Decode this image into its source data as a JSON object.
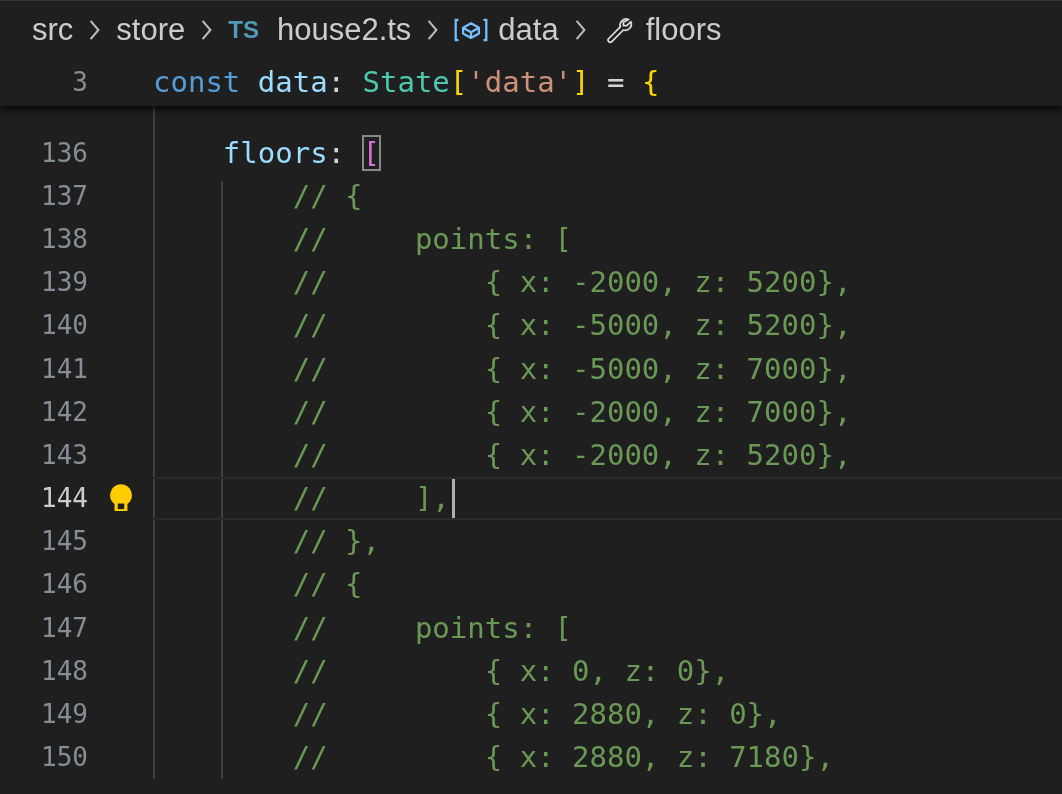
{
  "breadcrumb": [
    {
      "kind": "folder",
      "label": "src"
    },
    {
      "kind": "folder",
      "label": "store"
    },
    {
      "kind": "file",
      "badge": "TS",
      "label": "house2.ts"
    },
    {
      "kind": "variable",
      "label": "data"
    },
    {
      "kind": "property",
      "label": "floors"
    }
  ],
  "sticky_line": {
    "number": "3",
    "tokens": [
      {
        "kind": "keyword",
        "text": "const "
      },
      {
        "kind": "variable",
        "text": "data"
      },
      {
        "kind": "plain",
        "text": ": "
      },
      {
        "kind": "type",
        "text": "State"
      },
      {
        "kind": "bracket",
        "text": "["
      },
      {
        "kind": "string",
        "text": "'data'"
      },
      {
        "kind": "bracket",
        "text": "]"
      },
      {
        "kind": "plain",
        "text": " = "
      },
      {
        "kind": "bracket",
        "text": "{"
      }
    ]
  },
  "lines": [
    {
      "number": "136",
      "current": false,
      "tokens": [
        {
          "kind": "variable",
          "text": "    floors"
        },
        {
          "kind": "plain",
          "text": ": "
        },
        {
          "kind": "bracket2",
          "text": "[",
          "matched": true
        }
      ]
    },
    {
      "number": "137",
      "current": false,
      "tokens": [
        {
          "kind": "comment",
          "text": "        // {"
        }
      ]
    },
    {
      "number": "138",
      "current": false,
      "tokens": [
        {
          "kind": "comment",
          "text": "        //     points: ["
        }
      ]
    },
    {
      "number": "139",
      "current": false,
      "tokens": [
        {
          "kind": "comment",
          "text": "        //         { x: -2000, z: 5200},"
        }
      ]
    },
    {
      "number": "140",
      "current": false,
      "tokens": [
        {
          "kind": "comment",
          "text": "        //         { x: -5000, z: 5200},"
        }
      ]
    },
    {
      "number": "141",
      "current": false,
      "tokens": [
        {
          "kind": "comment",
          "text": "        //         { x: -5000, z: 7000},"
        }
      ]
    },
    {
      "number": "142",
      "current": false,
      "tokens": [
        {
          "kind": "comment",
          "text": "        //         { x: -2000, z: 7000},"
        }
      ]
    },
    {
      "number": "143",
      "current": false,
      "tokens": [
        {
          "kind": "comment",
          "text": "        //         { x: -2000, z: 5200},"
        }
      ]
    },
    {
      "number": "144",
      "current": true,
      "tokens": [
        {
          "kind": "comment",
          "text": "        //     ],"
        }
      ]
    },
    {
      "number": "145",
      "current": false,
      "tokens": [
        {
          "kind": "comment",
          "text": "        // },"
        }
      ]
    },
    {
      "number": "146",
      "current": false,
      "tokens": [
        {
          "kind": "comment",
          "text": "        // {"
        }
      ]
    },
    {
      "number": "147",
      "current": false,
      "tokens": [
        {
          "kind": "comment",
          "text": "        //     points: ["
        }
      ]
    },
    {
      "number": "148",
      "current": false,
      "tokens": [
        {
          "kind": "comment",
          "text": "        //         { x: 0, z: 0},"
        }
      ]
    },
    {
      "number": "149",
      "current": false,
      "tokens": [
        {
          "kind": "comment",
          "text": "        //         { x: 2880, z: 0},"
        }
      ]
    },
    {
      "number": "150",
      "current": false,
      "tokens": [
        {
          "kind": "comment",
          "text": "        //         { x: 2880, z: 7180},"
        }
      ]
    }
  ]
}
